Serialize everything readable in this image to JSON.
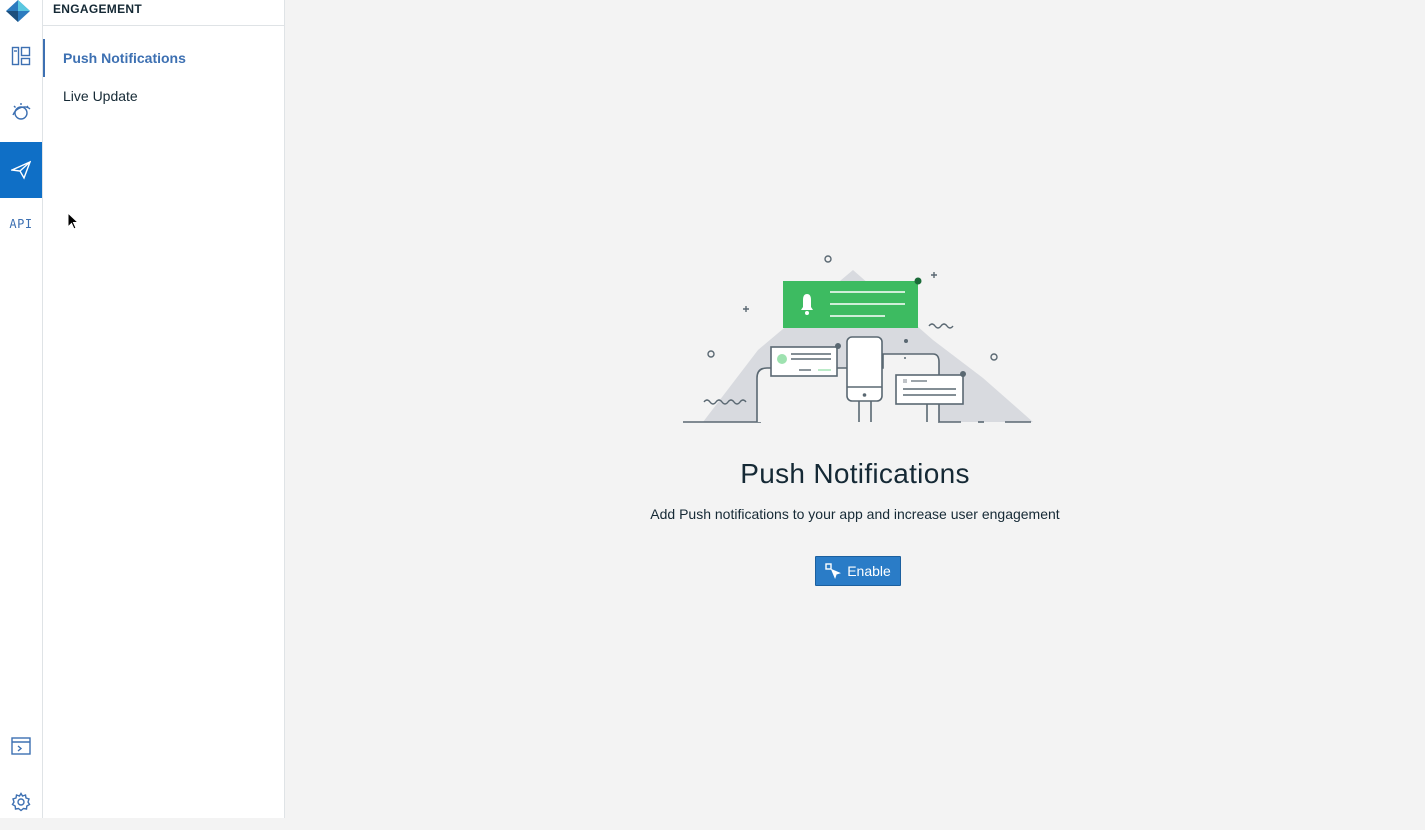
{
  "sidebar": {
    "section_title": "ENGAGEMENT",
    "items": [
      {
        "label": "Push Notifications",
        "active": true
      },
      {
        "label": "Live Update",
        "active": false
      }
    ]
  },
  "rail": {
    "icons": [
      "logo-icon",
      "dashboard-icon",
      "analytics-icon",
      "engagement-icon",
      "api-icon",
      "console-icon",
      "settings-icon"
    ],
    "api_label": "API",
    "active_color": "#0f6fc6"
  },
  "main": {
    "title": "Push Notifications",
    "subtitle": "Add Push notifications to your app and increase user engagement",
    "enable_label": "Enable",
    "accent_color": "#2a7cc7",
    "illustration_color": "#3dbb61"
  }
}
